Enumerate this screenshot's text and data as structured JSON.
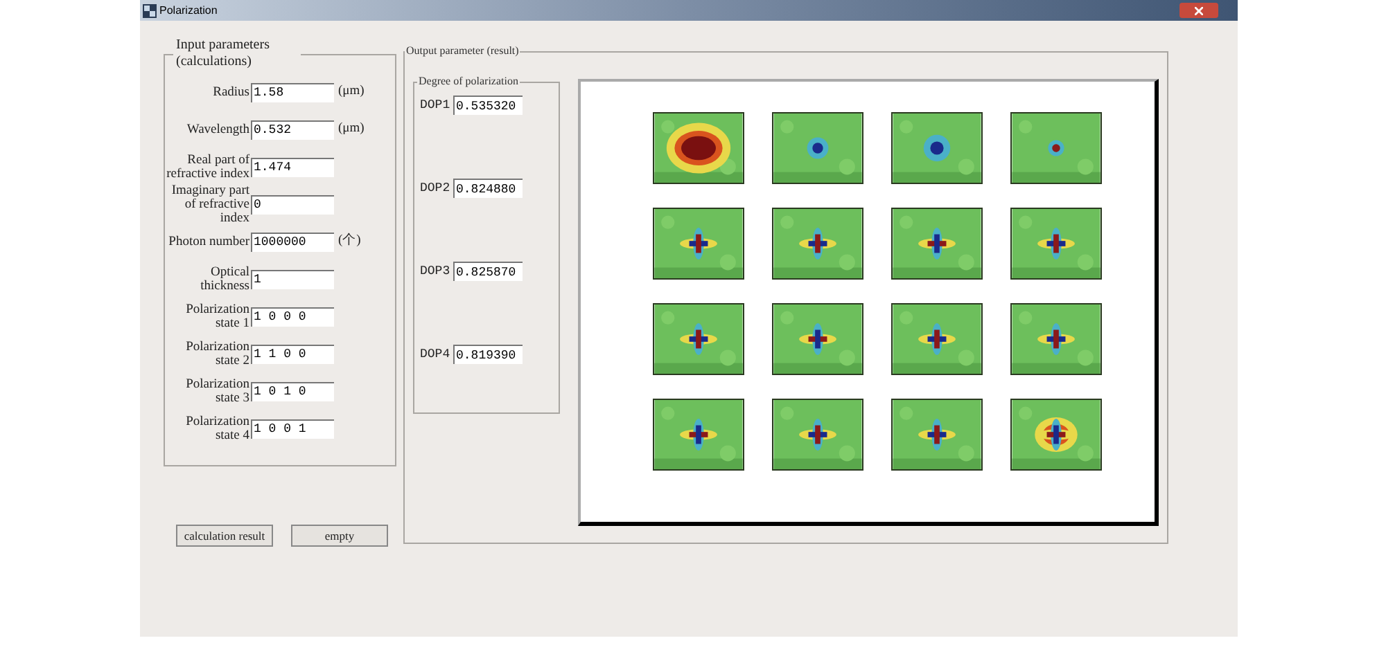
{
  "window": {
    "title": "Polarization"
  },
  "input_parameters": {
    "title": "Input parameters (calculations)",
    "fields": [
      {
        "label": "Radius",
        "value": "1.58",
        "unit": "(μm)"
      },
      {
        "label": "Wavelength",
        "value": "0.532",
        "unit": "(μm)"
      },
      {
        "label": "Real part of refractive index",
        "value": "1.474"
      },
      {
        "label": "Imaginary part of refractive index",
        "value": "0"
      },
      {
        "label": "Photon number",
        "value": "1000000",
        "unit": "(个)"
      },
      {
        "label": "Optical thickness",
        "value": "1"
      },
      {
        "label": "Polarization state 1",
        "value": "1 0 0 0"
      },
      {
        "label": "Polarization state 2",
        "value": "1 1 0 0"
      },
      {
        "label": "Polarization state 3",
        "value": "1 0 1 0"
      },
      {
        "label": "Polarization state 4",
        "value": "1 0 0 1"
      }
    ]
  },
  "buttons": [
    {
      "label": "calculation result"
    },
    {
      "label": "empty"
    }
  ],
  "output": {
    "title": "Output parameter (result)",
    "degree_of_polarization": {
      "title": "Degree of polarization",
      "fields": [
        {
          "label": "DOP1",
          "value": "0.535320"
        },
        {
          "label": "DOP2",
          "value": "0.824880"
        },
        {
          "label": "DOP3",
          "value": "0.825870"
        },
        {
          "label": "DOP4",
          "value": "0.819390"
        }
      ]
    }
  }
}
